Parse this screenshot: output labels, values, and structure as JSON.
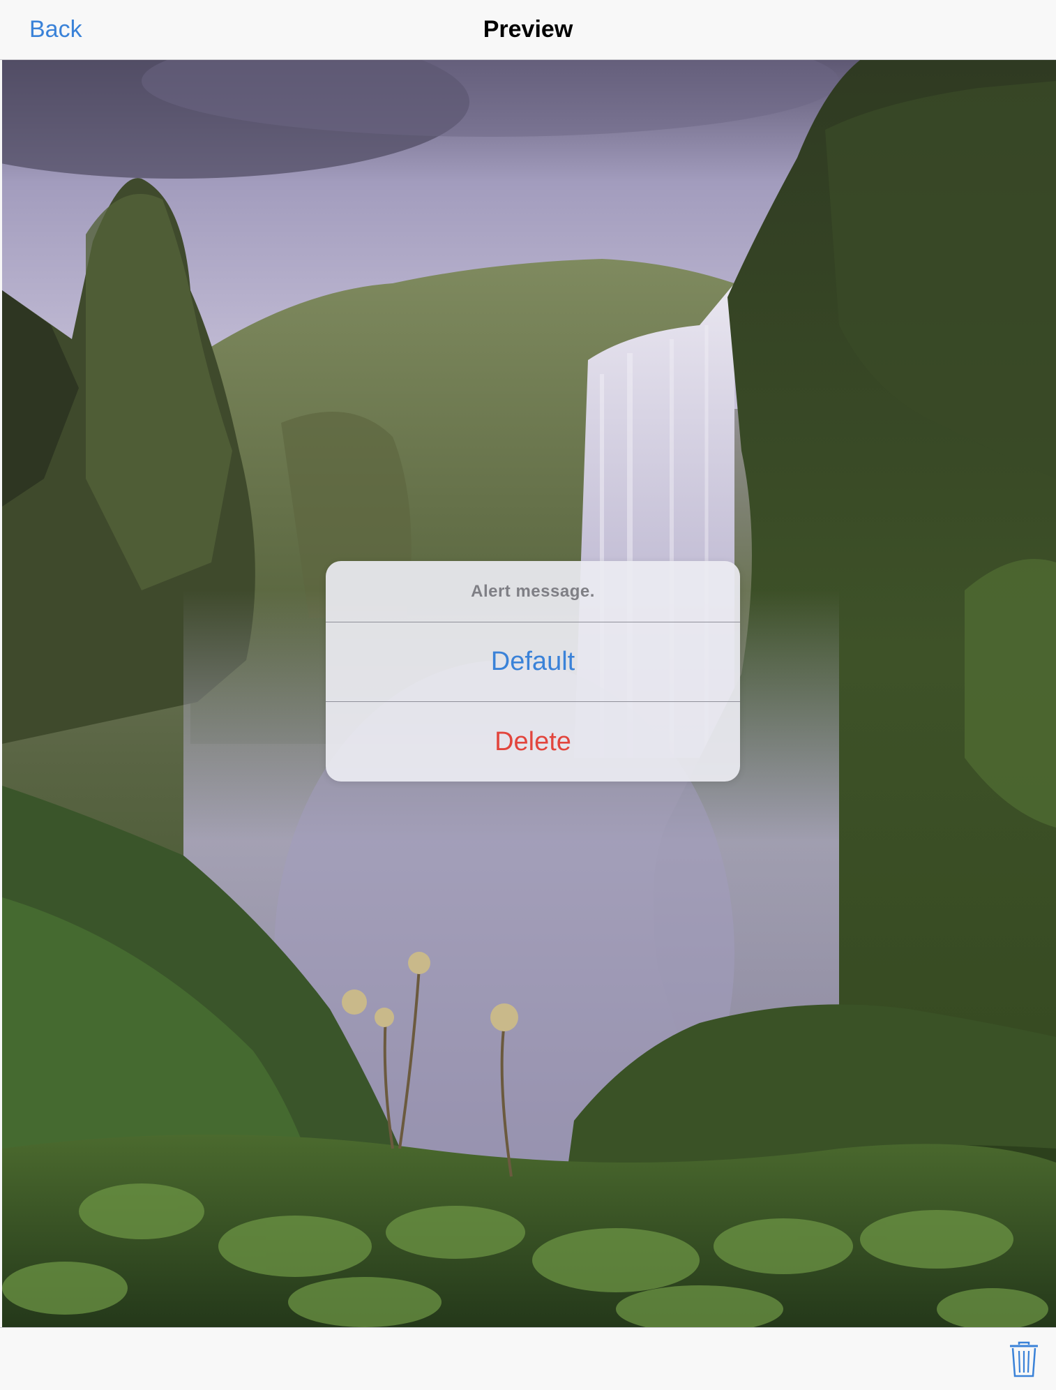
{
  "navbar": {
    "back_label": "Back",
    "title": "Preview"
  },
  "photo": {
    "subject": "waterfall landscape"
  },
  "alert": {
    "message": "Alert message.",
    "actions": [
      {
        "label": "Default",
        "style": "default",
        "color": "#3a82d8"
      },
      {
        "label": "Delete",
        "style": "destructive",
        "color": "#e2453d"
      }
    ]
  },
  "toolbar": {
    "trash_icon": "trash-icon"
  },
  "colors": {
    "accent": "#3a82d8",
    "destructive": "#e2453d",
    "bar_background": "#f8f8f8"
  }
}
